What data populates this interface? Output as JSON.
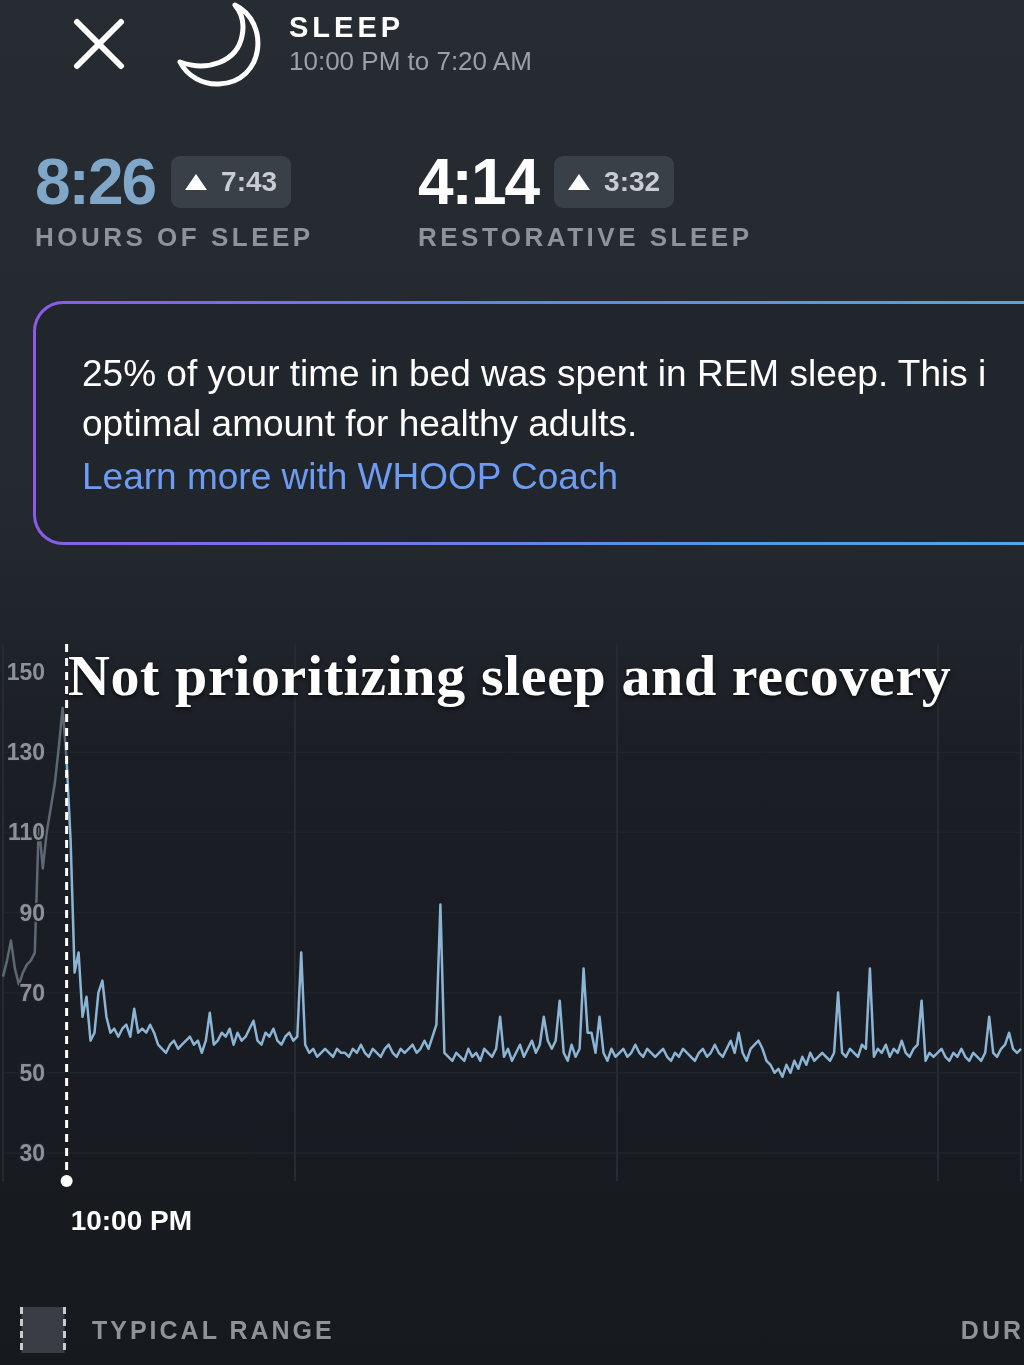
{
  "header": {
    "title": "SLEEP",
    "subtitle": "10:00 PM to 7:20 AM"
  },
  "stats": [
    {
      "value": "8:26",
      "color": "#80a7c7",
      "change": "7:43",
      "label": "HOURS OF SLEEP"
    },
    {
      "value": "4:14",
      "color": "#ffffff",
      "change": "3:32",
      "label": "RESTORATIVE SLEEP"
    }
  ],
  "insight": {
    "lines": [
      "25% of your time in bed was spent in REM sleep. This i",
      "optimal amount for healthy adults."
    ],
    "link": "Learn more with WHOOP Coach"
  },
  "chart": {
    "caption": "Not prioritizing sleep and recovery",
    "chart_data": {
      "type": "line",
      "grid": true,
      "ylim": [
        23,
        157
      ],
      "yticks": [
        150,
        130,
        110,
        90,
        70,
        50,
        30
      ],
      "annotations": [
        "10:00 PM"
      ],
      "series": [
        {
          "color": "#5d6873",
          "values": [
            74,
            78,
            83,
            76,
            72,
            75,
            77,
            78,
            80,
            112,
            101,
            110,
            116,
            122,
            131,
            141,
            128,
            null,
            null,
            null,
            null,
            null,
            null,
            null,
            null,
            null,
            null,
            null,
            null,
            null,
            null,
            null,
            null,
            null,
            null,
            null,
            null,
            null,
            null,
            null,
            null,
            null,
            null,
            null,
            null,
            null,
            null,
            null,
            null,
            null,
            null,
            null,
            null,
            null,
            null,
            null,
            null,
            null,
            null,
            null,
            null,
            null,
            null,
            null,
            null,
            null,
            null,
            null,
            null,
            null,
            null,
            null,
            null,
            null,
            null,
            null,
            null,
            null,
            null,
            null,
            null,
            null,
            null,
            null,
            null,
            null,
            null,
            null,
            null,
            null,
            null,
            null,
            null,
            null,
            null,
            null,
            null,
            null,
            null,
            null,
            null,
            null,
            null,
            null,
            null,
            null,
            null,
            null,
            null,
            null,
            null,
            null,
            null,
            null,
            null,
            null,
            null,
            null,
            null,
            null,
            null,
            null,
            null,
            null,
            null,
            null,
            null,
            null,
            null,
            null,
            null,
            null,
            null,
            null,
            null,
            null,
            null,
            null,
            null,
            null,
            null,
            null,
            null,
            null,
            null,
            null,
            null,
            null,
            null,
            null,
            null,
            null,
            null,
            null,
            null,
            null,
            null,
            null,
            null,
            null,
            null,
            null,
            null,
            null,
            null,
            null,
            null,
            null,
            null,
            null,
            null,
            null,
            null,
            null,
            null,
            null,
            null,
            null,
            null,
            null,
            null,
            null,
            null,
            null,
            null,
            null,
            null,
            null,
            null,
            null,
            null,
            null,
            null,
            null,
            null,
            null,
            null,
            null,
            null,
            null,
            null,
            null,
            null,
            null,
            null,
            null,
            null,
            null,
            null,
            null,
            null,
            null,
            null,
            null,
            null,
            null,
            null,
            null,
            null,
            null,
            null,
            null,
            null,
            null,
            null,
            null,
            null,
            null,
            null,
            null,
            null,
            null,
            null,
            null,
            null,
            null,
            null,
            null,
            null,
            null,
            null,
            null,
            null,
            null,
            null,
            null
          ]
        },
        {
          "color": "#8cb4d4",
          "values": [
            null,
            null,
            null,
            null,
            null,
            null,
            null,
            null,
            null,
            null,
            null,
            null,
            null,
            null,
            null,
            null,
            128,
            108,
            75,
            80,
            64,
            69,
            58,
            60,
            70,
            73,
            64,
            60,
            61,
            59,
            61,
            62,
            59,
            66,
            60,
            61,
            60,
            62,
            60,
            57,
            56,
            55,
            57,
            58,
            56,
            57,
            58,
            59,
            57,
            58,
            55,
            58,
            65,
            57,
            58,
            60,
            59,
            61,
            57,
            60,
            58,
            59,
            61,
            63,
            58,
            57,
            60,
            59,
            61,
            58,
            57,
            59,
            60,
            58,
            59,
            80,
            57,
            55,
            56,
            54,
            55,
            56,
            55,
            54,
            56,
            55,
            55,
            54,
            56,
            55,
            57,
            55,
            54,
            56,
            55,
            54,
            56,
            57,
            55,
            54,
            56,
            55,
            56,
            57,
            55,
            56,
            58,
            56,
            59,
            62,
            92,
            55,
            54,
            53,
            55,
            54,
            53,
            56,
            54,
            55,
            53,
            56,
            55,
            54,
            56,
            64,
            54,
            56,
            53,
            55,
            57,
            54,
            56,
            58,
            55,
            57,
            64,
            58,
            56,
            58,
            68,
            55,
            53,
            57,
            54,
            56,
            76,
            60,
            60,
            55,
            64,
            55,
            53,
            56,
            54,
            55,
            56,
            54,
            55,
            57,
            55,
            54,
            56,
            55,
            54,
            55,
            56,
            54,
            53,
            55,
            54,
            56,
            55,
            54,
            53,
            55,
            56,
            54,
            55,
            57,
            55,
            54,
            56,
            58,
            55,
            60,
            55,
            53,
            56,
            57,
            58,
            56,
            53,
            52,
            50,
            51,
            49,
            52,
            50,
            53,
            51,
            54,
            52,
            55,
            53,
            54,
            55,
            54,
            53,
            55,
            70,
            55,
            54,
            56,
            55,
            54,
            57,
            56,
            76,
            54,
            56,
            55,
            57,
            54,
            56,
            55,
            58,
            55,
            54,
            56,
            57,
            68,
            53,
            55,
            54,
            55,
            56,
            54,
            53,
            55,
            54,
            56,
            54,
            53,
            55,
            54,
            53,
            55,
            64,
            55,
            54,
            56,
            57,
            60,
            56,
            55,
            56
          ]
        }
      ]
    }
  },
  "legend": {
    "label": "TYPICAL RANGE",
    "column_2": "DUR"
  }
}
